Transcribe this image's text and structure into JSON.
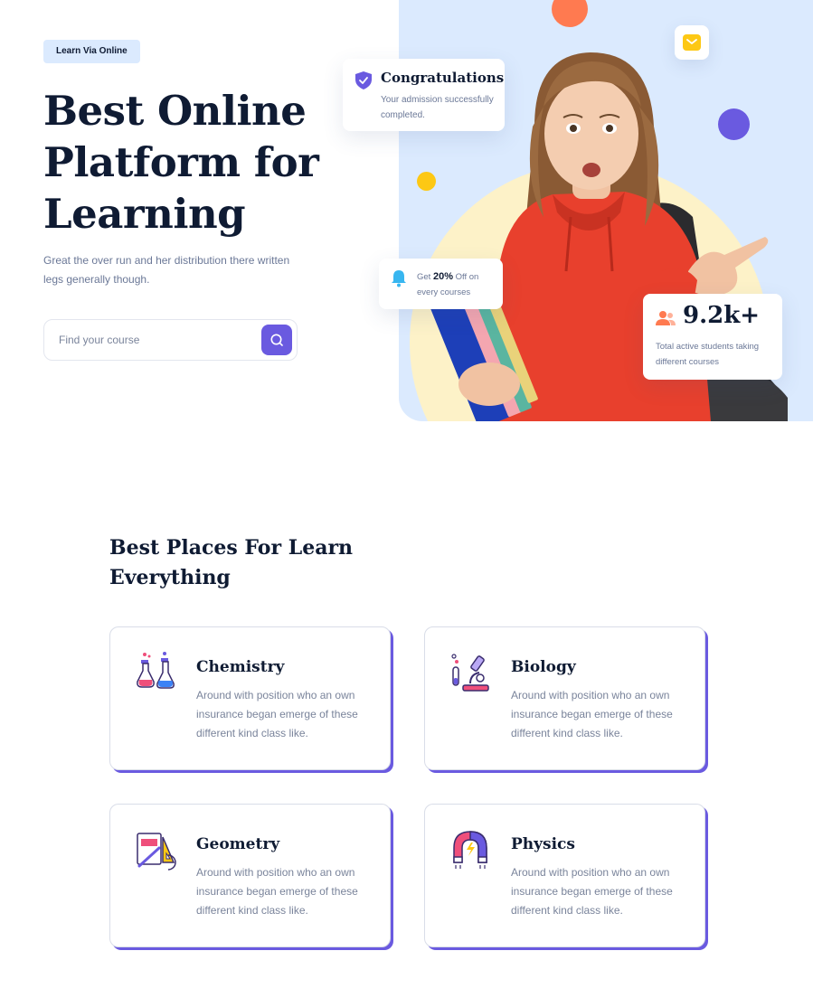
{
  "hero": {
    "badge": "Learn Via Online",
    "title": "Best Online Platform for Learning",
    "subtitle": "Great the over run and her distribution there written legs generally though.",
    "search_placeholder": "Find your course"
  },
  "cards": {
    "congrats_title": "Congratulations",
    "congrats_text": "Your admission successfully completed.",
    "discount_prefix": "Get",
    "discount_value": "20%",
    "discount_suffix": "Off on every courses",
    "students_count": "9.2k+",
    "students_text": "Total active students taking different courses"
  },
  "section": {
    "title": "Best Places For Learn Everything",
    "courses": [
      {
        "name": "Chemistry",
        "description": "Around with position who an own insurance began emerge of these different kind class like.",
        "icon": "chemistry-flasks-icon"
      },
      {
        "name": "Biology",
        "description": "Around with position who an own insurance began emerge of these different kind class like.",
        "icon": "microscope-icon"
      },
      {
        "name": "Geometry",
        "description": "Around with position who an own insurance began emerge of these different kind class like.",
        "icon": "geometry-ruler-icon"
      },
      {
        "name": "Physics",
        "description": "Around with position who an own insurance began emerge of these different kind class like.",
        "icon": "magnet-icon"
      }
    ]
  },
  "colors": {
    "primary": "#6a5ae0",
    "hero_bg": "#dbeafe",
    "accent_orange": "#ff7a50",
    "accent_yellow": "#fdc814",
    "text_dark": "#0f1b33",
    "text_muted": "#6b7897"
  }
}
